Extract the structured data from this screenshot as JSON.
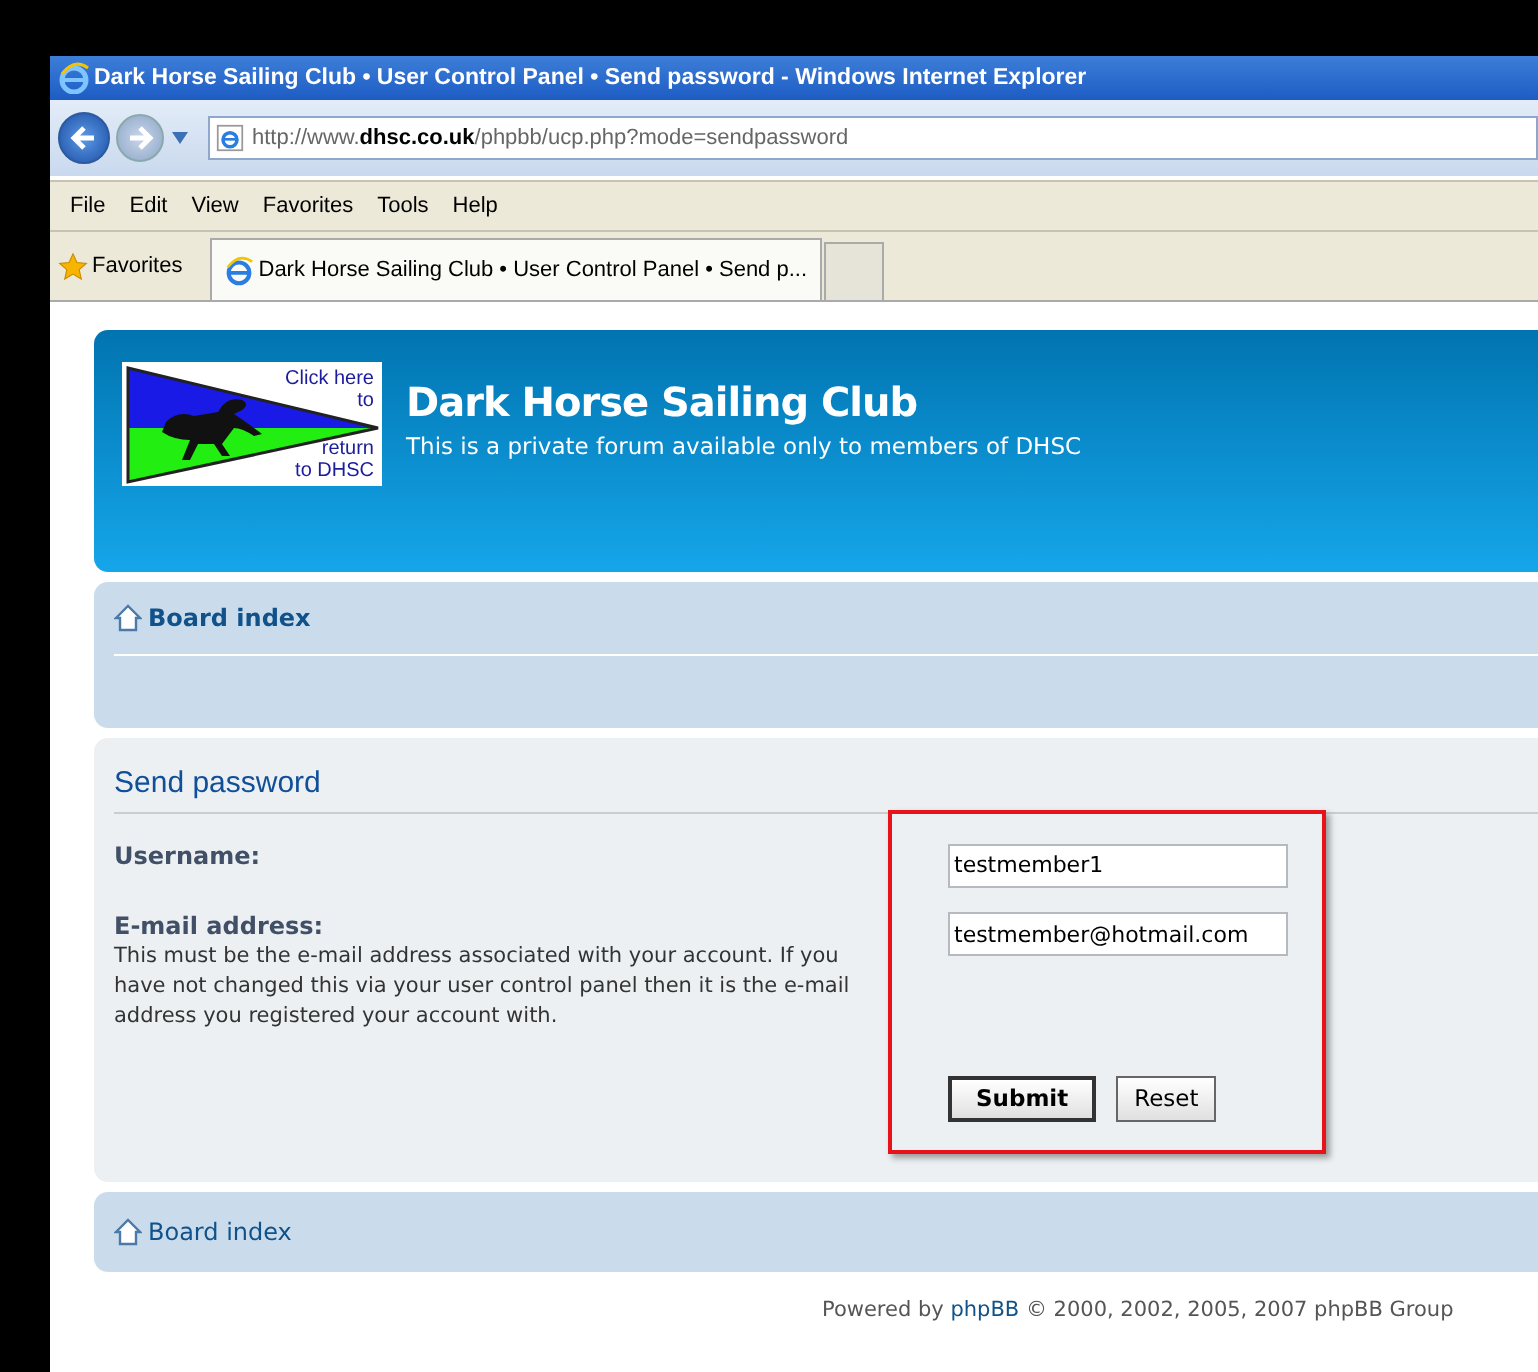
{
  "window": {
    "title": "Dark Horse Sailing Club • User Control Panel • Send password - Windows Internet Explorer"
  },
  "address_bar": {
    "url": "http://www.**dhsc.co.uk**/phpbb/ucp.php?mode=sendpassword"
  },
  "menu": [
    "File",
    "Edit",
    "View",
    "Favorites",
    "Tools",
    "Help"
  ],
  "favorites_bar": {
    "label": "Favorites",
    "tabs": [
      {
        "title": "Dark Horse Sailing Club • User Control Panel • Send p...",
        "selected": true
      }
    ]
  },
  "header": {
    "logo_text": [
      "Click here",
      "to",
      "return",
      "to DHSC"
    ],
    "title": "Dark Horse Sailing Club",
    "subtitle": "This is a private forum available only to members of DHSC"
  },
  "nav_top": {
    "link": "Board index"
  },
  "form": {
    "heading": "Send password",
    "fields": [
      {
        "label": "Username:",
        "value": "testmember1"
      },
      {
        "label": "E-mail address:",
        "value": "testmember@hotmail.com",
        "explain": "This must be the e-mail address associated with your account. If you have not changed this via your user control panel then it is the e-mail address you registered your account with."
      }
    ],
    "buttons": [
      {
        "label": "Submit",
        "kind": "primary"
      },
      {
        "label": "Reset",
        "kind": "secondary"
      }
    ]
  },
  "nav_bottom": {
    "link": "Board index"
  },
  "footer": {
    "prefix": "Powered by ",
    "link": "phpBB",
    "suffix": " © 2000, 2002, 2005, 2007 phpBB Group"
  }
}
